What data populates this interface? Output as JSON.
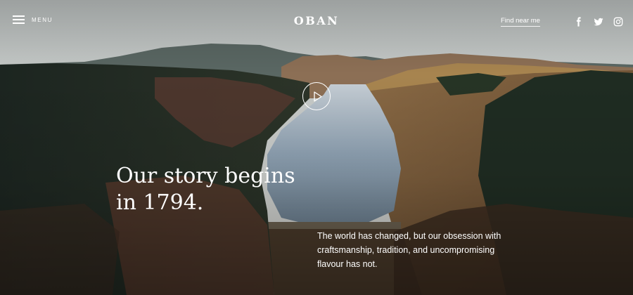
{
  "header": {
    "menu_label": "MENU",
    "logo": "OBAN",
    "find_link": "Find near me",
    "social": [
      {
        "icon": "facebook-icon",
        "glyph": "f"
      },
      {
        "icon": "twitter-icon"
      },
      {
        "icon": "instagram-icon"
      }
    ]
  },
  "hero": {
    "headline_line1": "Our story begins",
    "headline_line2": "in 1794.",
    "tagline": "The world has changed, but our obsession with craftsmanship, tradition, and uncompromising flavour has not.",
    "play_icon": "play-icon",
    "background": "aerial view of a loch between forested hills"
  },
  "colors": {
    "text": "#ffffff",
    "sky": "#c9ccc9",
    "forest": "#1f2a20",
    "heather": "#6b4533",
    "water": "#9fb3c4"
  }
}
